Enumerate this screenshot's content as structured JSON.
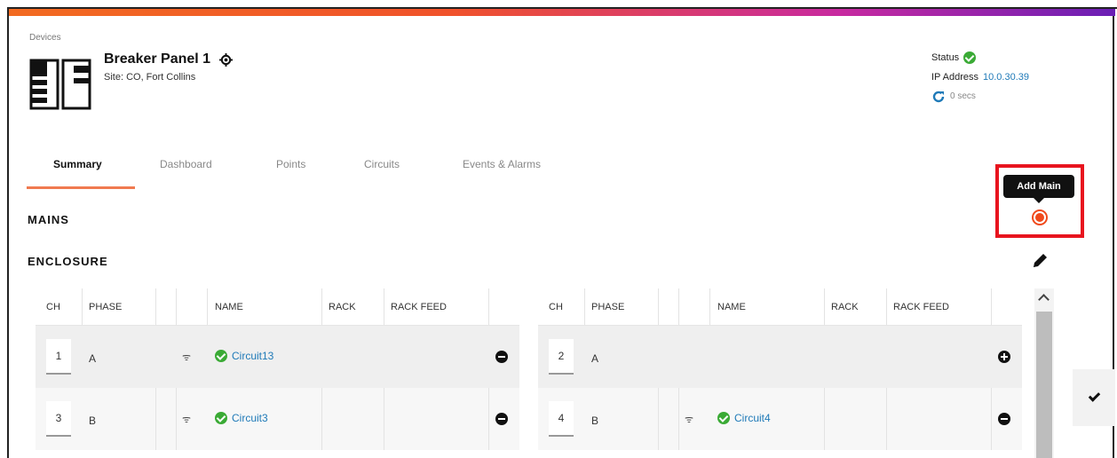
{
  "breadcrumb": "Devices",
  "device": {
    "name": "Breaker Panel 1",
    "site": "Site: CO, Fort Collins"
  },
  "status": {
    "label": "Status",
    "ip_label": "IP Address",
    "ip_value": "10.0.30.39",
    "refresh_text": "0 secs"
  },
  "tabs": [
    "Summary",
    "Dashboard",
    "Points",
    "Circuits",
    "Events & Alarms"
  ],
  "sections": {
    "mains": "MAINS",
    "enclosure": "ENCLOSURE"
  },
  "tooltip": "Add Main",
  "table_headers": [
    "CH",
    "PHASE",
    "NAME",
    "RACK",
    "RACK FEED"
  ],
  "left_rows": [
    {
      "ch": "1",
      "phase": "A",
      "circuit": "Circuit13"
    },
    {
      "ch": "3",
      "phase": "B",
      "circuit": "Circuit3"
    }
  ],
  "right_rows": [
    {
      "ch": "2",
      "phase": "A",
      "circuit": ""
    },
    {
      "ch": "4",
      "phase": "B",
      "circuit": "Circuit4"
    }
  ],
  "colors": {
    "accent": "#f07a50",
    "highlight": "#e8141e",
    "link": "#1f7ab8",
    "ok": "#3aaa35"
  },
  "icons": {
    "device": "breaker-panel-icon",
    "settings": "gear-icon",
    "status": "check-circle-icon",
    "refresh": "refresh-icon",
    "add": "add-circle-icon",
    "edit": "pencil-icon",
    "plug": "plug-icon",
    "remove": "minus-circle-icon",
    "confirm": "checkmark-icon"
  }
}
